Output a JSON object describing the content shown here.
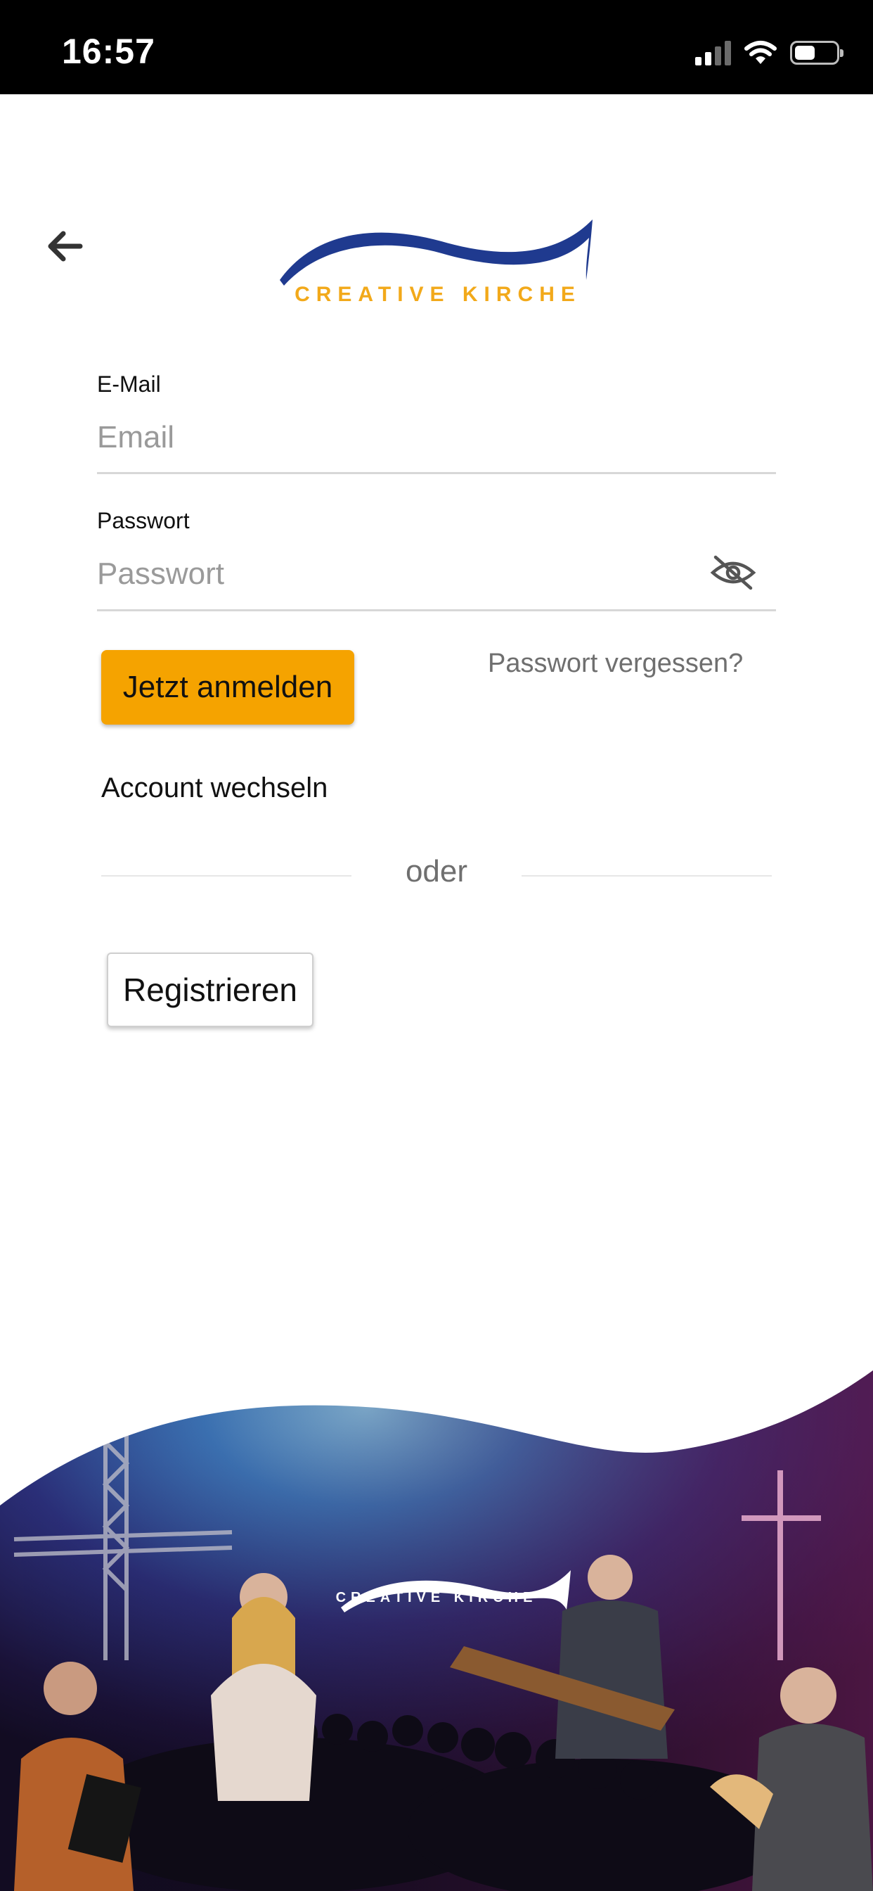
{
  "status_bar": {
    "time": "16:57",
    "icons": [
      "signal-icon",
      "wifi-icon",
      "battery-icon"
    ]
  },
  "header": {
    "back_icon": "arrow-left-icon",
    "logo_text": "CREATIVE KIRCHE"
  },
  "form": {
    "email": {
      "label": "E-Mail",
      "placeholder": "Email",
      "value": ""
    },
    "password": {
      "label": "Passwort",
      "placeholder": "Passwort",
      "value": "",
      "toggle_icon": "eye-off-icon"
    },
    "login_button": "Jetzt anmelden",
    "forgot_password": "Passwort vergessen?",
    "switch_account": "Account wechseln",
    "divider": "oder",
    "register_button": "Registrieren"
  },
  "banner": {
    "logo_text": "CREATIVE KIRCHE"
  },
  "colors": {
    "accent": "#f5a300",
    "logo_blue": "#1f3a8f",
    "logo_orange": "#f2a91a"
  }
}
